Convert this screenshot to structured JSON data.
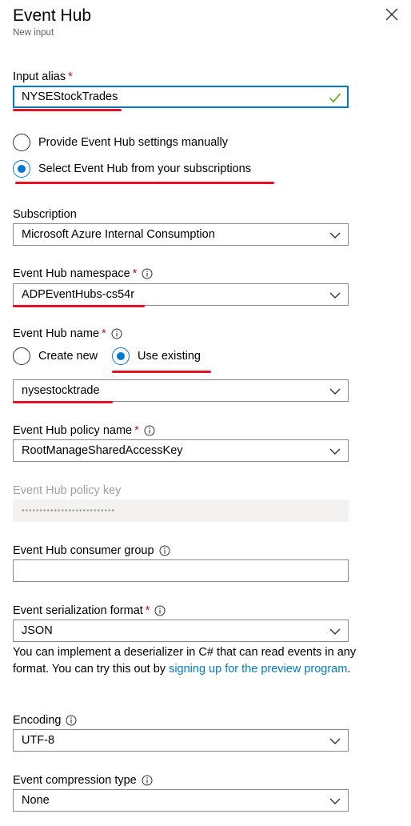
{
  "panel": {
    "title": "Event Hub",
    "subtitle": "New input"
  },
  "input_alias": {
    "label": "Input alias",
    "value": "NYSEStockTrades"
  },
  "source_choice": {
    "option_manual": "Provide Event Hub settings manually",
    "option_subscription": "Select Event Hub from your subscriptions",
    "selected": "option_subscription"
  },
  "subscription": {
    "label": "Subscription",
    "value": "Microsoft Azure Internal Consumption"
  },
  "namespace": {
    "label": "Event Hub namespace",
    "value": "ADPEventHubs-cs54r"
  },
  "hub_name": {
    "label": "Event Hub name",
    "option_create": "Create new",
    "option_existing": "Use existing",
    "selected": "option_existing",
    "value": "nysestocktrade"
  },
  "policy_name": {
    "label": "Event Hub policy name",
    "value": "RootManageSharedAccessKey"
  },
  "policy_key": {
    "label": "Event Hub policy key",
    "value": "••••••••••••••••••••••••••"
  },
  "consumer_group": {
    "label": "Event Hub consumer group",
    "value": ""
  },
  "serialization": {
    "label": "Event serialization format",
    "value": "JSON",
    "help_text": "You can implement a deserializer in C# that can read events in any format. You can try this out by ",
    "help_link": "signing up for the preview program",
    "help_end": "."
  },
  "encoding": {
    "label": "Encoding",
    "value": "UTF-8"
  },
  "compression": {
    "label": "Event compression type",
    "value": "None"
  },
  "required_marker": "*",
  "colors": {
    "accent": "#0078d4",
    "annotation": "#e81123",
    "success": "#57a300",
    "required": "#c50f1f"
  }
}
